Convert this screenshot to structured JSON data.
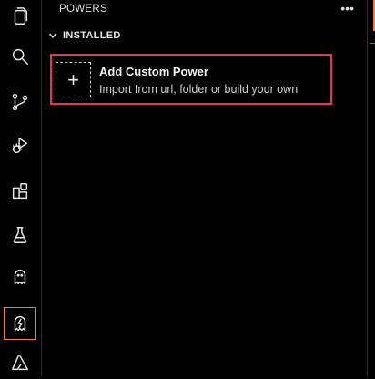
{
  "panel": {
    "title": "POWERS",
    "more_label": "•••"
  },
  "section": {
    "label": "INSTALLED"
  },
  "power": {
    "plus": "+",
    "title": "Add Custom Power",
    "subtitle": "Import from url, folder or build your own"
  },
  "colors": {
    "active_outline": "#f07c3c",
    "card_highlight": "#e8335a"
  },
  "activity_icons": [
    "explorer-icon",
    "search-icon",
    "source-control-icon",
    "run-debug-icon",
    "extensions-icon",
    "testing-icon",
    "ghost-icon",
    "powers-icon",
    "azure-icon"
  ]
}
